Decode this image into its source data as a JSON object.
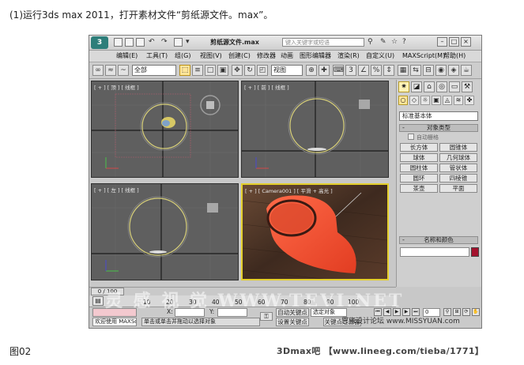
{
  "captions": {
    "top": "(1)运行3ds max 2011，打开素材文件“剪纸源文件。max”。",
    "figure": "图02",
    "credit": "3Dmax吧 【www.lineeg.com/tieba/1771】"
  },
  "titlebar": {
    "logo": "3",
    "title": "剪纸源文件.max",
    "search_placeholder": "键入关键字或短语"
  },
  "menu": [
    "编辑(E)",
    "工具(T)",
    "组(G)",
    "视图(V)",
    "创建(C)",
    "修改器",
    "动画",
    "图形编辑器",
    "渲染(R)",
    "自定义(U)",
    "MAXScript(M)",
    "帮助(H)"
  ],
  "toolbar": {
    "selection_filter": "全部",
    "reference_coord": "视图"
  },
  "viewports": {
    "top": "[ + ] [ 顶 ] [ 线框 ]",
    "front": "[ + ] [ 前 ] [ 线框 ]",
    "left": "[ + ] [ 左 ] [ 线框 ]",
    "camera": "[ + ] [ Camera001 ] [ 平滑 + 高光 ]"
  },
  "command_panel": {
    "category": "标准基本体",
    "object_type_header": "对象类型",
    "autogrid": "自动栅格",
    "objects": [
      "长方体",
      "圆锥体",
      "球体",
      "几何球体",
      "圆柱体",
      "管状体",
      "圆环",
      "四棱锥",
      "茶壶",
      "平面"
    ],
    "name_color_header": "名称和颜色",
    "swatch_color": "#a3112d"
  },
  "timeline": {
    "frame_display": "0 / 100",
    "ticks": [
      "10",
      "20",
      "30",
      "40",
      "50",
      "60",
      "70",
      "80",
      "90",
      "100"
    ]
  },
  "status": {
    "welcome": "欢迎使用 MAXSc",
    "prompt": "单击或单击并拖动以选择对象",
    "x_label": "X:",
    "y_label": "Y:",
    "auto_key": "自动关键点",
    "set_key": "设置关键点",
    "key_filter_sel": "选定对象",
    "key_filters": "关键点过滤器",
    "frame_value": "0"
  },
  "watermark": {
    "text": "灵 感 视 觉  WWW.TEVI.NET",
    "site": "思缘设计论坛 www.MISSYUAN.com"
  }
}
